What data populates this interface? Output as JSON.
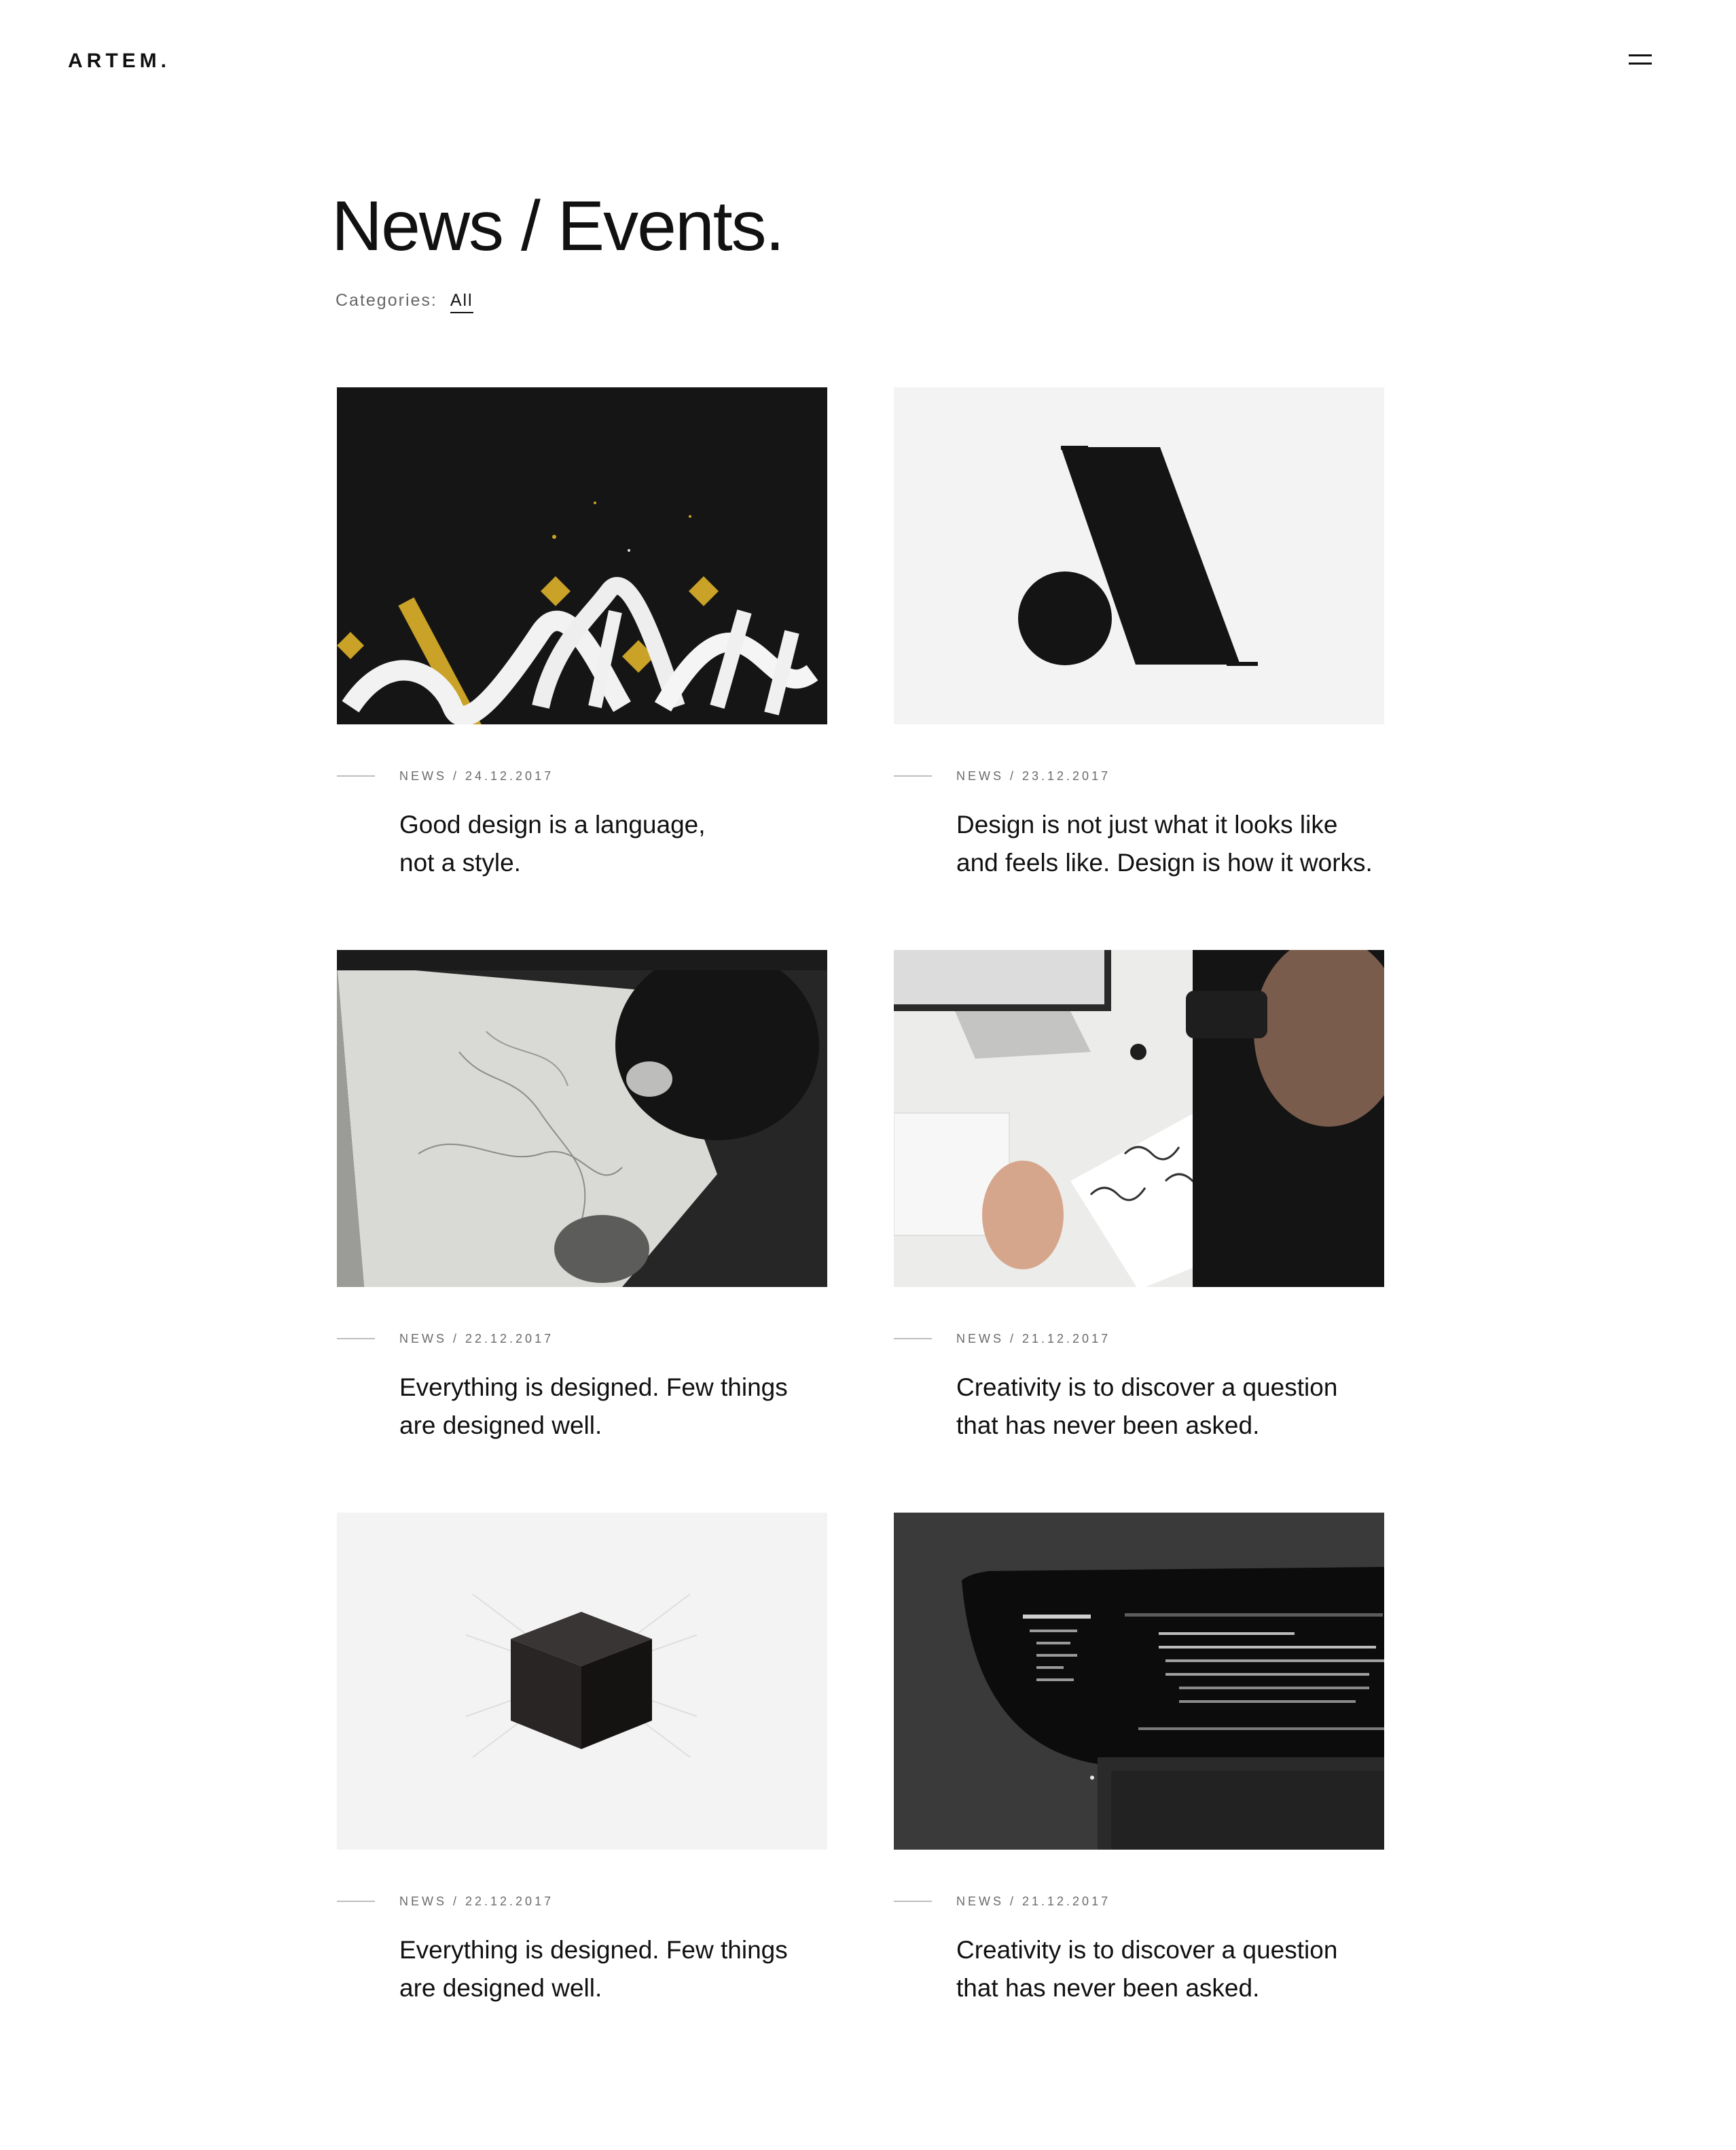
{
  "header": {
    "logo": "ARTEM.",
    "menu_icon": "hamburger-menu-icon"
  },
  "page": {
    "title": "News / Events.",
    "categories_label": "Categories:",
    "category_selected": "All"
  },
  "posts": [
    {
      "meta": "NEWS / 24.12.2017",
      "title_line1": "Good design is a language,",
      "title_line2": "not a style.",
      "image": "gold-calligraphy-on-black"
    },
    {
      "meta": "NEWS / 23.12.2017",
      "title_line1": "Design is not just what it looks like",
      "title_line2": "and feels like. Design is how it works.",
      "image": "letter-a-logo-mark"
    },
    {
      "meta": "NEWS / 22.12.2017",
      "title_line1": "Everything is designed. Few things",
      "title_line2": "are designed well.",
      "image": "person-drawing-sketch"
    },
    {
      "meta": "NEWS / 21.12.2017",
      "title_line1": "Creativity is to discover a question",
      "title_line2": "that has never been asked.",
      "image": "hand-lettering-at-desk"
    },
    {
      "meta": "NEWS / 22.12.2017",
      "title_line1": "Everything is designed. Few things",
      "title_line2": "are designed well.",
      "image": "black-cube-render"
    },
    {
      "meta": "NEWS / 21.12.2017",
      "title_line1": "Creativity is to discover a question",
      "title_line2": "that has never been asked.",
      "image": "laptop-code-editor"
    }
  ]
}
